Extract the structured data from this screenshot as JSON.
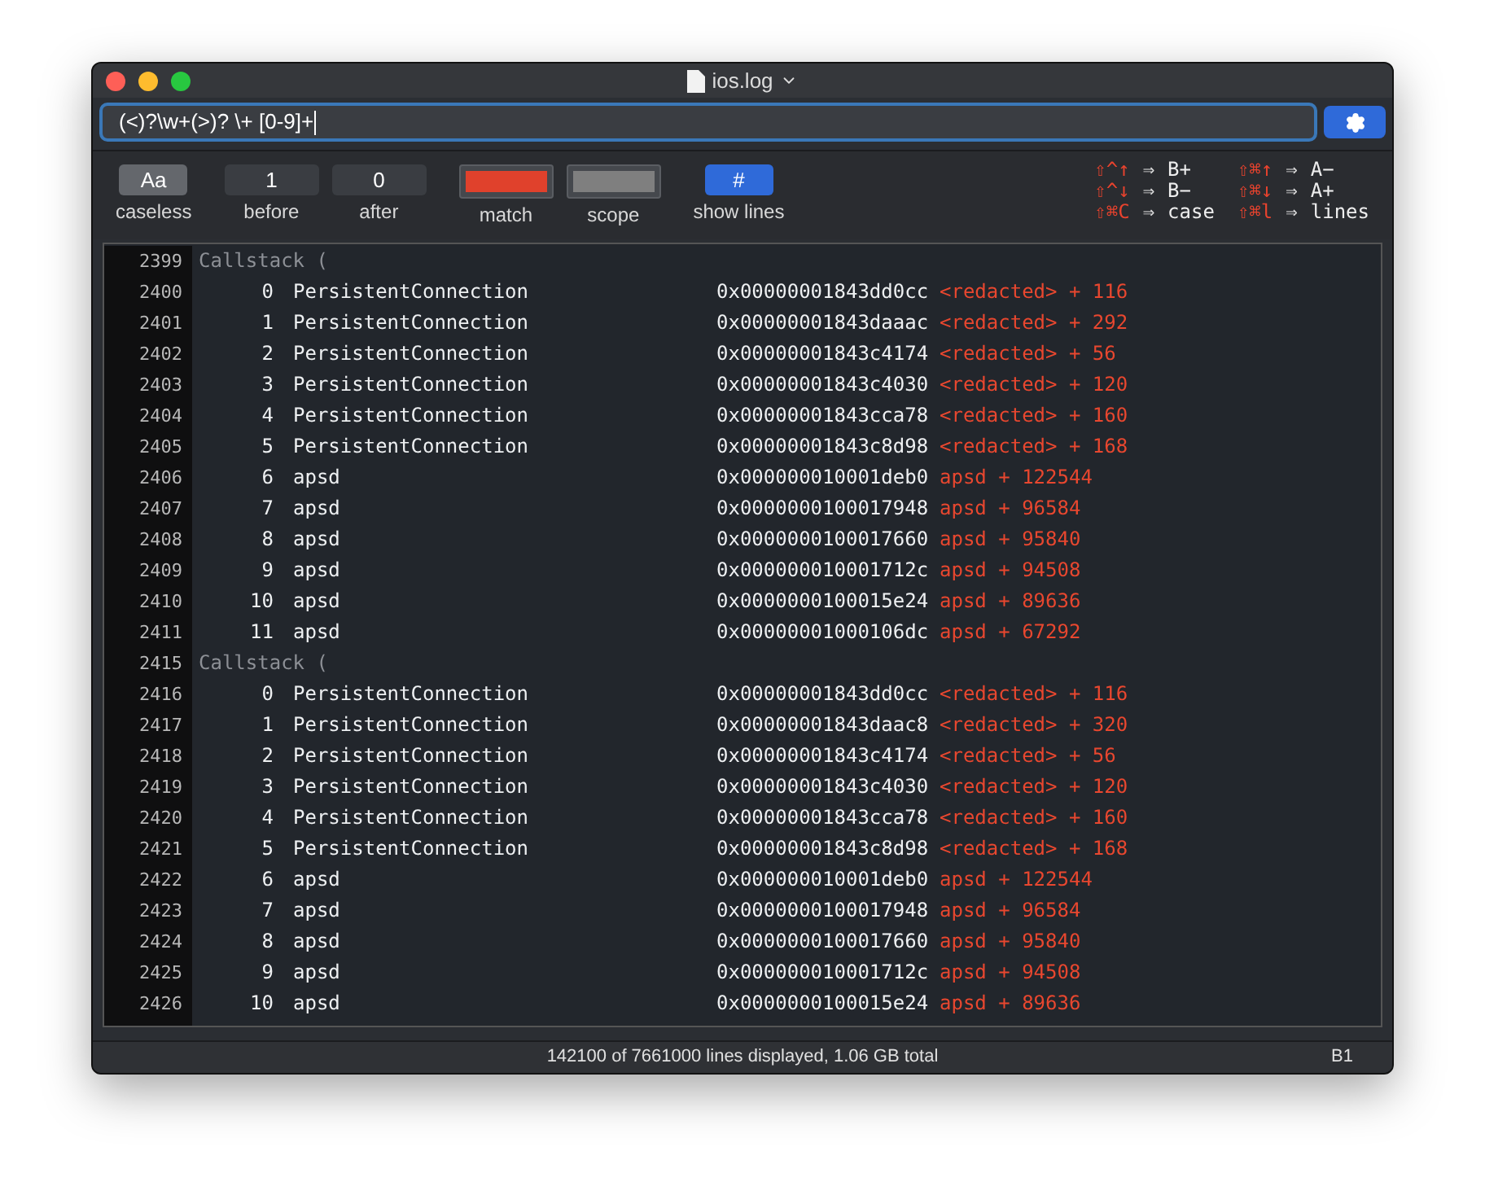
{
  "window": {
    "title": "ios.log"
  },
  "search": {
    "value": "(<)?\\w+(>)? \\+ [0-9]+"
  },
  "toolbar": {
    "caseless": {
      "label": "Aa",
      "caption": "caseless",
      "on": true
    },
    "before": {
      "value": "1",
      "caption": "before"
    },
    "after": {
      "value": "0",
      "caption": "after"
    },
    "match": {
      "caption": "match",
      "color": "#e0412c"
    },
    "scope": {
      "caption": "scope",
      "color": "#7f7f7f"
    },
    "show_lines": {
      "label": "#",
      "caption": "show lines",
      "on": true
    }
  },
  "shortcuts": [
    {
      "keys": "⇧^↑",
      "arrow": "⇒",
      "action": "B+"
    },
    {
      "keys": "⇧⌘↑",
      "arrow": "⇒",
      "action": "A−"
    },
    {
      "keys": "⇧^↓",
      "arrow": "⇒",
      "action": "B−"
    },
    {
      "keys": "⇧⌘↓",
      "arrow": "⇒",
      "action": "A+"
    },
    {
      "keys": "⇧⌘C",
      "arrow": "⇒",
      "action": "case"
    },
    {
      "keys": "⇧⌘l",
      "arrow": "⇒",
      "action": "lines"
    }
  ],
  "log": [
    {
      "line": "2399",
      "kind": "header",
      "text": "Callstack ("
    },
    {
      "line": "2400",
      "kind": "frame",
      "index": "0",
      "name": "PersistentConnection",
      "address": "0x00000001843dd0cc",
      "symbol": "<redacted> + 116"
    },
    {
      "line": "2401",
      "kind": "frame",
      "index": "1",
      "name": "PersistentConnection",
      "address": "0x00000001843daaac",
      "symbol": "<redacted> + 292"
    },
    {
      "line": "2402",
      "kind": "frame",
      "index": "2",
      "name": "PersistentConnection",
      "address": "0x00000001843c4174",
      "symbol": "<redacted> + 56"
    },
    {
      "line": "2403",
      "kind": "frame",
      "index": "3",
      "name": "PersistentConnection",
      "address": "0x00000001843c4030",
      "symbol": "<redacted> + 120"
    },
    {
      "line": "2404",
      "kind": "frame",
      "index": "4",
      "name": "PersistentConnection",
      "address": "0x00000001843cca78",
      "symbol": "<redacted> + 160"
    },
    {
      "line": "2405",
      "kind": "frame",
      "index": "5",
      "name": "PersistentConnection",
      "address": "0x00000001843c8d98",
      "symbol": "<redacted> + 168"
    },
    {
      "line": "2406",
      "kind": "frame",
      "index": "6",
      "name": "apsd",
      "address": "0x000000010001deb0",
      "symbol": "apsd + 122544"
    },
    {
      "line": "2407",
      "kind": "frame",
      "index": "7",
      "name": "apsd",
      "address": "0x0000000100017948",
      "symbol": "apsd + 96584"
    },
    {
      "line": "2408",
      "kind": "frame",
      "index": "8",
      "name": "apsd",
      "address": "0x0000000100017660",
      "symbol": "apsd + 95840"
    },
    {
      "line": "2409",
      "kind": "frame",
      "index": "9",
      "name": "apsd",
      "address": "0x000000010001712c",
      "symbol": "apsd + 94508"
    },
    {
      "line": "2410",
      "kind": "frame",
      "index": "10",
      "name": "apsd",
      "address": "0x0000000100015e24",
      "symbol": "apsd + 89636"
    },
    {
      "line": "2411",
      "kind": "frame",
      "index": "11",
      "name": "apsd",
      "address": "0x00000001000106dc",
      "symbol": "apsd + 67292"
    },
    {
      "line": "2415",
      "kind": "header",
      "text": "Callstack ("
    },
    {
      "line": "2416",
      "kind": "frame",
      "index": "0",
      "name": "PersistentConnection",
      "address": "0x00000001843dd0cc",
      "symbol": "<redacted> + 116"
    },
    {
      "line": "2417",
      "kind": "frame",
      "index": "1",
      "name": "PersistentConnection",
      "address": "0x00000001843daac8",
      "symbol": "<redacted> + 320"
    },
    {
      "line": "2418",
      "kind": "frame",
      "index": "2",
      "name": "PersistentConnection",
      "address": "0x00000001843c4174",
      "symbol": "<redacted> + 56"
    },
    {
      "line": "2419",
      "kind": "frame",
      "index": "3",
      "name": "PersistentConnection",
      "address": "0x00000001843c4030",
      "symbol": "<redacted> + 120"
    },
    {
      "line": "2420",
      "kind": "frame",
      "index": "4",
      "name": "PersistentConnection",
      "address": "0x00000001843cca78",
      "symbol": "<redacted> + 160"
    },
    {
      "line": "2421",
      "kind": "frame",
      "index": "5",
      "name": "PersistentConnection",
      "address": "0x00000001843c8d98",
      "symbol": "<redacted> + 168"
    },
    {
      "line": "2422",
      "kind": "frame",
      "index": "6",
      "name": "apsd",
      "address": "0x000000010001deb0",
      "symbol": "apsd + 122544"
    },
    {
      "line": "2423",
      "kind": "frame",
      "index": "7",
      "name": "apsd",
      "address": "0x0000000100017948",
      "symbol": "apsd + 96584"
    },
    {
      "line": "2424",
      "kind": "frame",
      "index": "8",
      "name": "apsd",
      "address": "0x0000000100017660",
      "symbol": "apsd + 95840"
    },
    {
      "line": "2425",
      "kind": "frame",
      "index": "9",
      "name": "apsd",
      "address": "0x000000010001712c",
      "symbol": "apsd + 94508"
    },
    {
      "line": "2426",
      "kind": "frame",
      "index": "10",
      "name": "apsd",
      "address": "0x0000000100015e24",
      "symbol": "apsd + 89636"
    }
  ],
  "status_bar": {
    "text": "142100 of 7661000 lines displayed, 1.06 GB total",
    "mode": "B1"
  }
}
